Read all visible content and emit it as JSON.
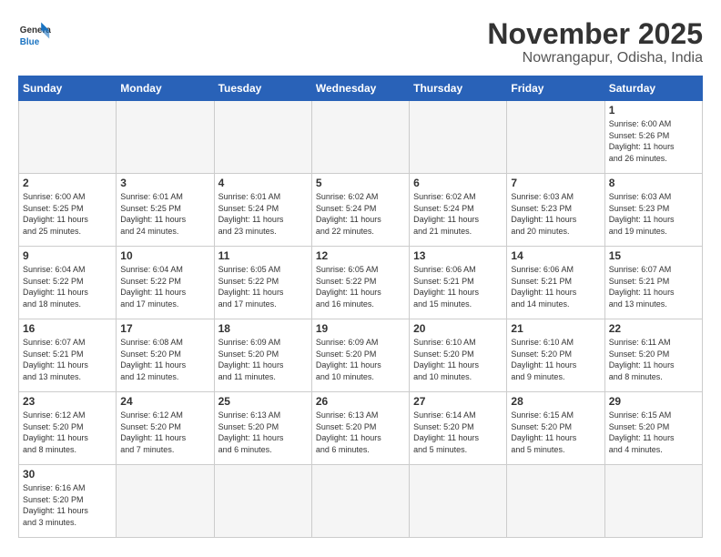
{
  "logo": {
    "general": "General",
    "blue": "Blue"
  },
  "title": "November 2025",
  "subtitle": "Nowrangapur, Odisha, India",
  "days_of_week": [
    "Sunday",
    "Monday",
    "Tuesday",
    "Wednesday",
    "Thursday",
    "Friday",
    "Saturday"
  ],
  "weeks": [
    [
      {
        "day": "",
        "info": ""
      },
      {
        "day": "",
        "info": ""
      },
      {
        "day": "",
        "info": ""
      },
      {
        "day": "",
        "info": ""
      },
      {
        "day": "",
        "info": ""
      },
      {
        "day": "",
        "info": ""
      },
      {
        "day": "1",
        "info": "Sunrise: 6:00 AM\nSunset: 5:26 PM\nDaylight: 11 hours\nand 26 minutes."
      }
    ],
    [
      {
        "day": "2",
        "info": "Sunrise: 6:00 AM\nSunset: 5:25 PM\nDaylight: 11 hours\nand 25 minutes."
      },
      {
        "day": "3",
        "info": "Sunrise: 6:01 AM\nSunset: 5:25 PM\nDaylight: 11 hours\nand 24 minutes."
      },
      {
        "day": "4",
        "info": "Sunrise: 6:01 AM\nSunset: 5:24 PM\nDaylight: 11 hours\nand 23 minutes."
      },
      {
        "day": "5",
        "info": "Sunrise: 6:02 AM\nSunset: 5:24 PM\nDaylight: 11 hours\nand 22 minutes."
      },
      {
        "day": "6",
        "info": "Sunrise: 6:02 AM\nSunset: 5:24 PM\nDaylight: 11 hours\nand 21 minutes."
      },
      {
        "day": "7",
        "info": "Sunrise: 6:03 AM\nSunset: 5:23 PM\nDaylight: 11 hours\nand 20 minutes."
      },
      {
        "day": "8",
        "info": "Sunrise: 6:03 AM\nSunset: 5:23 PM\nDaylight: 11 hours\nand 19 minutes."
      }
    ],
    [
      {
        "day": "9",
        "info": "Sunrise: 6:04 AM\nSunset: 5:22 PM\nDaylight: 11 hours\nand 18 minutes."
      },
      {
        "day": "10",
        "info": "Sunrise: 6:04 AM\nSunset: 5:22 PM\nDaylight: 11 hours\nand 17 minutes."
      },
      {
        "day": "11",
        "info": "Sunrise: 6:05 AM\nSunset: 5:22 PM\nDaylight: 11 hours\nand 17 minutes."
      },
      {
        "day": "12",
        "info": "Sunrise: 6:05 AM\nSunset: 5:22 PM\nDaylight: 11 hours\nand 16 minutes."
      },
      {
        "day": "13",
        "info": "Sunrise: 6:06 AM\nSunset: 5:21 PM\nDaylight: 11 hours\nand 15 minutes."
      },
      {
        "day": "14",
        "info": "Sunrise: 6:06 AM\nSunset: 5:21 PM\nDaylight: 11 hours\nand 14 minutes."
      },
      {
        "day": "15",
        "info": "Sunrise: 6:07 AM\nSunset: 5:21 PM\nDaylight: 11 hours\nand 13 minutes."
      }
    ],
    [
      {
        "day": "16",
        "info": "Sunrise: 6:07 AM\nSunset: 5:21 PM\nDaylight: 11 hours\nand 13 minutes."
      },
      {
        "day": "17",
        "info": "Sunrise: 6:08 AM\nSunset: 5:20 PM\nDaylight: 11 hours\nand 12 minutes."
      },
      {
        "day": "18",
        "info": "Sunrise: 6:09 AM\nSunset: 5:20 PM\nDaylight: 11 hours\nand 11 minutes."
      },
      {
        "day": "19",
        "info": "Sunrise: 6:09 AM\nSunset: 5:20 PM\nDaylight: 11 hours\nand 10 minutes."
      },
      {
        "day": "20",
        "info": "Sunrise: 6:10 AM\nSunset: 5:20 PM\nDaylight: 11 hours\nand 10 minutes."
      },
      {
        "day": "21",
        "info": "Sunrise: 6:10 AM\nSunset: 5:20 PM\nDaylight: 11 hours\nand 9 minutes."
      },
      {
        "day": "22",
        "info": "Sunrise: 6:11 AM\nSunset: 5:20 PM\nDaylight: 11 hours\nand 8 minutes."
      }
    ],
    [
      {
        "day": "23",
        "info": "Sunrise: 6:12 AM\nSunset: 5:20 PM\nDaylight: 11 hours\nand 8 minutes."
      },
      {
        "day": "24",
        "info": "Sunrise: 6:12 AM\nSunset: 5:20 PM\nDaylight: 11 hours\nand 7 minutes."
      },
      {
        "day": "25",
        "info": "Sunrise: 6:13 AM\nSunset: 5:20 PM\nDaylight: 11 hours\nand 6 minutes."
      },
      {
        "day": "26",
        "info": "Sunrise: 6:13 AM\nSunset: 5:20 PM\nDaylight: 11 hours\nand 6 minutes."
      },
      {
        "day": "27",
        "info": "Sunrise: 6:14 AM\nSunset: 5:20 PM\nDaylight: 11 hours\nand 5 minutes."
      },
      {
        "day": "28",
        "info": "Sunrise: 6:15 AM\nSunset: 5:20 PM\nDaylight: 11 hours\nand 5 minutes."
      },
      {
        "day": "29",
        "info": "Sunrise: 6:15 AM\nSunset: 5:20 PM\nDaylight: 11 hours\nand 4 minutes."
      }
    ],
    [
      {
        "day": "30",
        "info": "Sunrise: 6:16 AM\nSunset: 5:20 PM\nDaylight: 11 hours\nand 3 minutes."
      },
      {
        "day": "",
        "info": ""
      },
      {
        "day": "",
        "info": ""
      },
      {
        "day": "",
        "info": ""
      },
      {
        "day": "",
        "info": ""
      },
      {
        "day": "",
        "info": ""
      },
      {
        "day": "",
        "info": ""
      }
    ]
  ]
}
